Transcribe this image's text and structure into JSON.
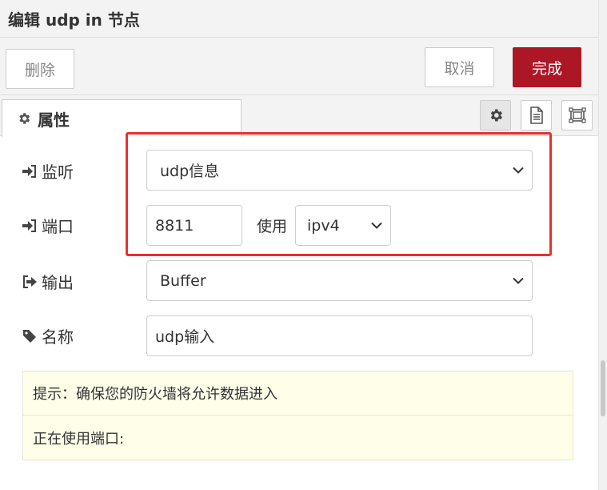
{
  "header": {
    "title": "编辑 udp in 节点"
  },
  "toolbar": {
    "delete_label": "删除",
    "cancel_label": "取消",
    "done_label": "完成",
    "done_color": "#ad1625"
  },
  "tabs": {
    "properties_label": "属性"
  },
  "icons": {
    "tab": "gear-icon",
    "side": [
      "gear-icon",
      "document-icon",
      "frame-icon"
    ]
  },
  "form": {
    "listen": {
      "label": "监听",
      "value": "udp信息",
      "icon": "sign-in-icon"
    },
    "port": {
      "label": "端口",
      "value": "8811",
      "use_label": "使用",
      "ip_value": "ipv4",
      "icon": "sign-in-icon"
    },
    "output": {
      "label": "输出",
      "value": "Buffer",
      "icon": "sign-out-icon"
    },
    "name": {
      "label": "名称",
      "value": "udp输入",
      "icon": "tag-icon"
    }
  },
  "tips": {
    "firewall": "提示：确保您的防火墙将允许数据进入",
    "port_in_use": "正在使用端口:"
  },
  "highlight_color": "#e8312f"
}
